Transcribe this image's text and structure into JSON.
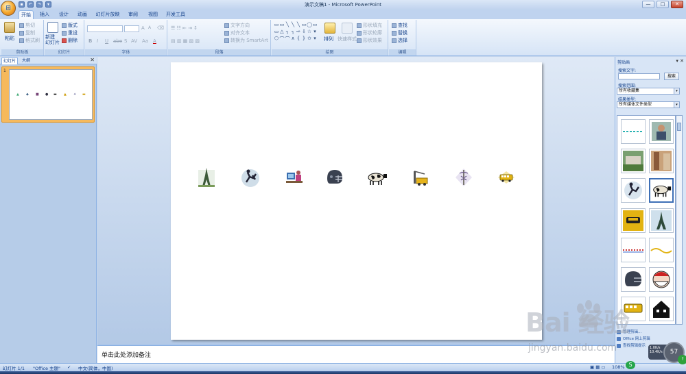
{
  "window": {
    "title": "演示文稿1 - Microsoft PowerPoint"
  },
  "office_button": {
    "label": "⊞"
  },
  "qat": {
    "save": "▪",
    "undo": "↶",
    "redo": "↷",
    "more": "▾"
  },
  "window_controls": {
    "minimize": "—",
    "maximize": "□",
    "close": "✕"
  },
  "tabs": [
    "开始",
    "插入",
    "设计",
    "动画",
    "幻灯片放映",
    "审阅",
    "视图",
    "开发工具"
  ],
  "ribbon": {
    "clipboard": {
      "paste": "粘贴",
      "cut": "剪切",
      "copy": "复制",
      "format_painter": "格式刷",
      "label": "剪贴板"
    },
    "slides": {
      "new_slide": "新建\n幻灯片",
      "layout": "版式",
      "reset": "重设",
      "delete": "删除",
      "label": "幻灯片"
    },
    "font": {
      "label": "字体",
      "bold": "B",
      "italic": "I",
      "underline": "U",
      "strike": "abe",
      "shadow": "S",
      "spacing": "AV",
      "case": "Aa",
      "color": "A",
      "grow": "A",
      "shrink": "A"
    },
    "paragraph": {
      "label": "段落",
      "text_direction": "文字方向",
      "align_text": "对齐文本",
      "convert_smartart": "转换为 SmartArt"
    },
    "drawing": {
      "label": "绘图",
      "arrange": "排列",
      "quick_styles": "快速样式",
      "shape_fill": "形状填充",
      "shape_outline": "形状轮廓",
      "shape_effects": "形状效果"
    },
    "editing": {
      "label": "编辑",
      "find": "查找",
      "replace": "替换",
      "select": "选择"
    }
  },
  "left_pane": {
    "tab_slides": "幻灯片",
    "tab_outline": "大纲",
    "close": "✕",
    "slide_number": "1"
  },
  "notes_placeholder": "单击此处添加备注",
  "task_pane": {
    "title": "剪贴画",
    "controls": "▾ ✕",
    "search_label": "搜索文字:",
    "search_button": "搜索",
    "scope_label": "搜索范围:",
    "scope_value": "所有收藏集",
    "type_label": "结果类型:",
    "type_value": "所有媒体文件类型",
    "links": [
      "管理剪辑...",
      "Office 网上剪辑",
      "查找剪辑提示"
    ]
  },
  "status_bar": {
    "slide_indicator": "幻灯片 1/1",
    "theme": "\"Office 主题\"",
    "language": "中文(简体，中国)",
    "zoom": "108%"
  },
  "watermark": {
    "brand": "Bai  经验",
    "url": "jingyan.baidu.com"
  },
  "widget": {
    "clock": "57",
    "net_up": "1.0K/s",
    "net_down": "10.4K/s"
  }
}
